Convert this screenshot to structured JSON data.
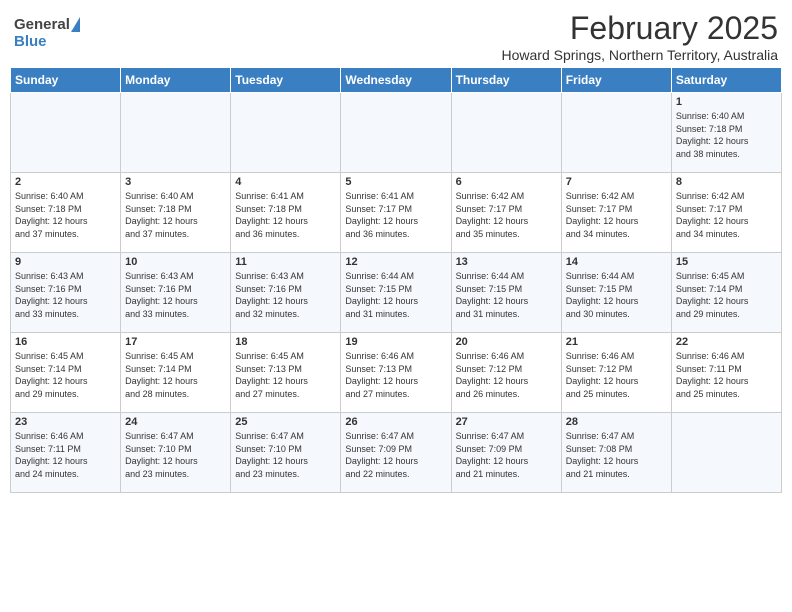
{
  "header": {
    "logo_general": "General",
    "logo_blue": "Blue",
    "month_year": "February 2025",
    "location": "Howard Springs, Northern Territory, Australia"
  },
  "days_of_week": [
    "Sunday",
    "Monday",
    "Tuesday",
    "Wednesday",
    "Thursday",
    "Friday",
    "Saturday"
  ],
  "weeks": [
    [
      {
        "day": "",
        "content": ""
      },
      {
        "day": "",
        "content": ""
      },
      {
        "day": "",
        "content": ""
      },
      {
        "day": "",
        "content": ""
      },
      {
        "day": "",
        "content": ""
      },
      {
        "day": "",
        "content": ""
      },
      {
        "day": "1",
        "content": "Sunrise: 6:40 AM\nSunset: 7:18 PM\nDaylight: 12 hours\nand 38 minutes."
      }
    ],
    [
      {
        "day": "2",
        "content": "Sunrise: 6:40 AM\nSunset: 7:18 PM\nDaylight: 12 hours\nand 37 minutes."
      },
      {
        "day": "3",
        "content": "Sunrise: 6:40 AM\nSunset: 7:18 PM\nDaylight: 12 hours\nand 37 minutes."
      },
      {
        "day": "4",
        "content": "Sunrise: 6:41 AM\nSunset: 7:18 PM\nDaylight: 12 hours\nand 36 minutes."
      },
      {
        "day": "5",
        "content": "Sunrise: 6:41 AM\nSunset: 7:17 PM\nDaylight: 12 hours\nand 36 minutes."
      },
      {
        "day": "6",
        "content": "Sunrise: 6:42 AM\nSunset: 7:17 PM\nDaylight: 12 hours\nand 35 minutes."
      },
      {
        "day": "7",
        "content": "Sunrise: 6:42 AM\nSunset: 7:17 PM\nDaylight: 12 hours\nand 34 minutes."
      },
      {
        "day": "8",
        "content": "Sunrise: 6:42 AM\nSunset: 7:17 PM\nDaylight: 12 hours\nand 34 minutes."
      }
    ],
    [
      {
        "day": "9",
        "content": "Sunrise: 6:43 AM\nSunset: 7:16 PM\nDaylight: 12 hours\nand 33 minutes."
      },
      {
        "day": "10",
        "content": "Sunrise: 6:43 AM\nSunset: 7:16 PM\nDaylight: 12 hours\nand 33 minutes."
      },
      {
        "day": "11",
        "content": "Sunrise: 6:43 AM\nSunset: 7:16 PM\nDaylight: 12 hours\nand 32 minutes."
      },
      {
        "day": "12",
        "content": "Sunrise: 6:44 AM\nSunset: 7:15 PM\nDaylight: 12 hours\nand 31 minutes."
      },
      {
        "day": "13",
        "content": "Sunrise: 6:44 AM\nSunset: 7:15 PM\nDaylight: 12 hours\nand 31 minutes."
      },
      {
        "day": "14",
        "content": "Sunrise: 6:44 AM\nSunset: 7:15 PM\nDaylight: 12 hours\nand 30 minutes."
      },
      {
        "day": "15",
        "content": "Sunrise: 6:45 AM\nSunset: 7:14 PM\nDaylight: 12 hours\nand 29 minutes."
      }
    ],
    [
      {
        "day": "16",
        "content": "Sunrise: 6:45 AM\nSunset: 7:14 PM\nDaylight: 12 hours\nand 29 minutes."
      },
      {
        "day": "17",
        "content": "Sunrise: 6:45 AM\nSunset: 7:14 PM\nDaylight: 12 hours\nand 28 minutes."
      },
      {
        "day": "18",
        "content": "Sunrise: 6:45 AM\nSunset: 7:13 PM\nDaylight: 12 hours\nand 27 minutes."
      },
      {
        "day": "19",
        "content": "Sunrise: 6:46 AM\nSunset: 7:13 PM\nDaylight: 12 hours\nand 27 minutes."
      },
      {
        "day": "20",
        "content": "Sunrise: 6:46 AM\nSunset: 7:12 PM\nDaylight: 12 hours\nand 26 minutes."
      },
      {
        "day": "21",
        "content": "Sunrise: 6:46 AM\nSunset: 7:12 PM\nDaylight: 12 hours\nand 25 minutes."
      },
      {
        "day": "22",
        "content": "Sunrise: 6:46 AM\nSunset: 7:11 PM\nDaylight: 12 hours\nand 25 minutes."
      }
    ],
    [
      {
        "day": "23",
        "content": "Sunrise: 6:46 AM\nSunset: 7:11 PM\nDaylight: 12 hours\nand 24 minutes."
      },
      {
        "day": "24",
        "content": "Sunrise: 6:47 AM\nSunset: 7:10 PM\nDaylight: 12 hours\nand 23 minutes."
      },
      {
        "day": "25",
        "content": "Sunrise: 6:47 AM\nSunset: 7:10 PM\nDaylight: 12 hours\nand 23 minutes."
      },
      {
        "day": "26",
        "content": "Sunrise: 6:47 AM\nSunset: 7:09 PM\nDaylight: 12 hours\nand 22 minutes."
      },
      {
        "day": "27",
        "content": "Sunrise: 6:47 AM\nSunset: 7:09 PM\nDaylight: 12 hours\nand 21 minutes."
      },
      {
        "day": "28",
        "content": "Sunrise: 6:47 AM\nSunset: 7:08 PM\nDaylight: 12 hours\nand 21 minutes."
      },
      {
        "day": "",
        "content": ""
      }
    ]
  ]
}
